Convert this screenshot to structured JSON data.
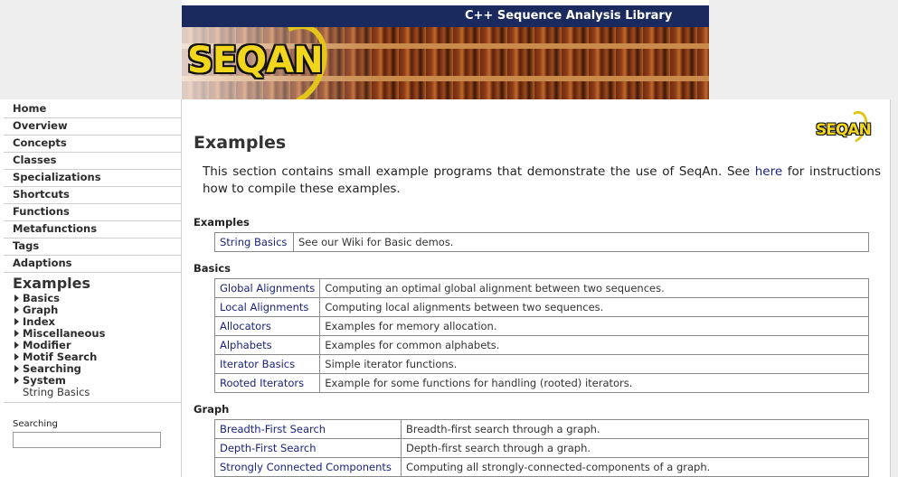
{
  "header": {
    "title": "C++ Sequence Analysis Library",
    "logo_text": "SEQAN"
  },
  "sidebar": {
    "nav": [
      "Home",
      "Overview",
      "Concepts",
      "Classes",
      "Specializations",
      "Shortcuts",
      "Functions",
      "Metafunctions",
      "Tags",
      "Adaptions"
    ],
    "examples_title": "Examples",
    "sub_items": [
      "Basics",
      "Graph",
      "Index",
      "Miscellaneous",
      "Modifier",
      "Motif Search",
      "Searching",
      "System"
    ],
    "current_item": "String Basics",
    "search": {
      "label": "Searching",
      "value": ""
    }
  },
  "content": {
    "logo_text": "SEQAN",
    "title": "Examples",
    "intro_before": "This section contains small example programs that demonstrate the use of SeqAn. See ",
    "intro_link": "here",
    "intro_after": " for instructions how to compile these examples.",
    "sections": [
      {
        "heading": "Examples",
        "rows": [
          {
            "name": "String Basics",
            "desc": "See our Wiki for Basic demos."
          }
        ]
      },
      {
        "heading": "Basics",
        "rows": [
          {
            "name": "Global Alignments",
            "desc": "Computing an optimal global alignment between two sequences."
          },
          {
            "name": "Local Alignments",
            "desc": "Computing local alignments between two sequences."
          },
          {
            "name": "Allocators",
            "desc": "Examples for memory allocation."
          },
          {
            "name": "Alphabets",
            "desc": "Examples for common alphabets."
          },
          {
            "name": "Iterator Basics",
            "desc": "Simple iterator functions."
          },
          {
            "name": "Rooted Iterators",
            "desc": "Example for some functions for handling (rooted) iterators."
          }
        ]
      },
      {
        "heading": "Graph",
        "rows": [
          {
            "name": "Breadth-First Search",
            "desc": "Breadth-first search through a graph."
          },
          {
            "name": "Depth-First Search",
            "desc": "Depth-first search through a graph."
          },
          {
            "name": "Strongly Connected Components",
            "desc": "Computing all strongly-connected-components of a graph."
          }
        ]
      }
    ]
  }
}
